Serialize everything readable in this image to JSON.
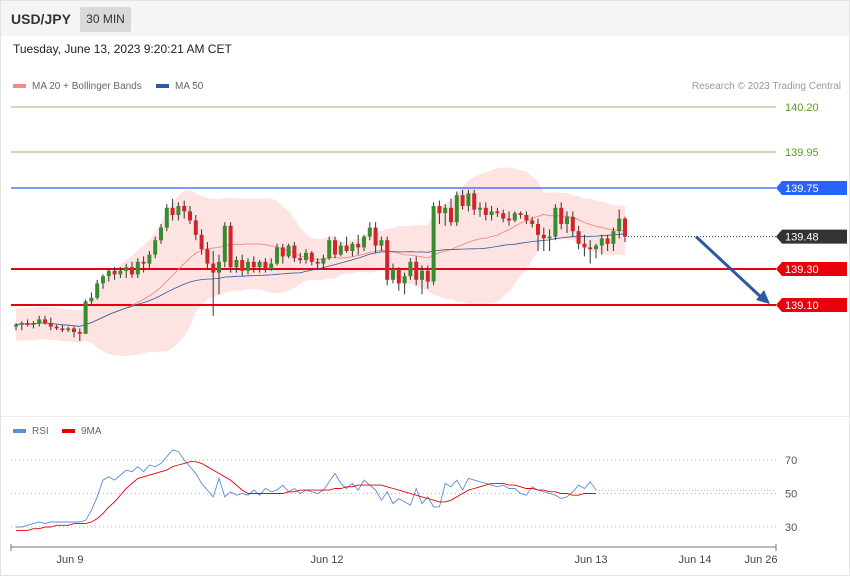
{
  "header": {
    "symbol": "USD/JPY",
    "timeframe": "30 MIN"
  },
  "timestamp": "Tuesday, June 13, 2023 9:20:21 AM CET",
  "legend": {
    "ma20": {
      "label": "MA 20 + Bollinger Bands",
      "color": "#f28b82"
    },
    "ma50": {
      "label": "MA 50",
      "color": "#2c5aa0"
    },
    "rsi": {
      "label": "RSI",
      "color": "#5b8dd9"
    },
    "ma9": {
      "label": "9MA",
      "color": "#e8000b"
    }
  },
  "credit": "Research © 2023 Trading Central",
  "chart_data": {
    "type": "candlestick",
    "y_range": [
      139.03,
      139.85
    ],
    "levels": [
      {
        "value": 140.2,
        "label": "140.20",
        "color": "#5a9e1f",
        "style": "target"
      },
      {
        "value": 139.95,
        "label": "139.95",
        "color": "#5a9e1f",
        "style": "target"
      },
      {
        "value": 139.75,
        "label": "139.75",
        "color": "#2962ff",
        "style": "resistance"
      },
      {
        "value": 139.48,
        "label": "139.48",
        "color": "#333333",
        "style": "last"
      },
      {
        "value": 139.3,
        "label": "139.30",
        "color": "#e8000b",
        "style": "support"
      },
      {
        "value": 139.1,
        "label": "139.10",
        "color": "#e8000b",
        "style": "support"
      }
    ],
    "forecast_arrow": {
      "from": 139.48,
      "to": 139.1,
      "direction": "down",
      "color": "#2c5aa0"
    },
    "x_labels": [
      "Jun 9",
      "Jun 12",
      "Jun 13",
      "Jun 14",
      "Jun 26"
    ],
    "candles": [
      [
        138.98,
        139.0,
        138.96,
        138.99
      ],
      [
        138.99,
        139.01,
        138.96,
        139.0
      ],
      [
        139.0,
        139.02,
        138.98,
        138.99
      ],
      [
        138.99,
        139.01,
        138.97,
        139.0
      ],
      [
        139.0,
        139.04,
        138.98,
        139.02
      ],
      [
        139.02,
        139.04,
        138.99,
        139.0
      ],
      [
        139.0,
        139.03,
        138.96,
        138.98
      ],
      [
        138.98,
        138.99,
        138.96,
        138.97
      ],
      [
        138.97,
        138.99,
        138.95,
        138.96
      ],
      [
        138.96,
        138.98,
        138.95,
        138.97
      ],
      [
        138.97,
        138.98,
        138.92,
        138.95
      ],
      [
        138.95,
        138.97,
        138.9,
        138.94
      ],
      [
        138.94,
        139.13,
        138.94,
        139.12
      ],
      [
        139.12,
        139.17,
        139.1,
        139.14
      ],
      [
        139.14,
        139.24,
        139.13,
        139.22
      ],
      [
        139.22,
        139.27,
        139.19,
        139.26
      ],
      [
        139.26,
        139.3,
        139.23,
        139.29
      ],
      [
        139.29,
        139.31,
        139.24,
        139.27
      ],
      [
        139.27,
        139.31,
        139.25,
        139.29
      ],
      [
        139.29,
        139.33,
        139.25,
        139.31
      ],
      [
        139.31,
        139.34,
        139.25,
        139.27
      ],
      [
        139.27,
        139.36,
        139.25,
        139.34
      ],
      [
        139.34,
        139.37,
        139.28,
        139.33
      ],
      [
        139.33,
        139.4,
        139.3,
        139.38
      ],
      [
        139.38,
        139.48,
        139.36,
        139.46
      ],
      [
        139.46,
        139.55,
        139.44,
        139.53
      ],
      [
        139.53,
        139.66,
        139.51,
        139.64
      ],
      [
        139.64,
        139.69,
        139.57,
        139.6
      ],
      [
        139.6,
        139.67,
        139.57,
        139.65
      ],
      [
        139.65,
        139.68,
        139.58,
        139.62
      ],
      [
        139.62,
        139.65,
        139.55,
        139.57
      ],
      [
        139.57,
        139.6,
        139.46,
        139.49
      ],
      [
        139.49,
        139.52,
        139.38,
        139.41
      ],
      [
        139.41,
        139.45,
        139.3,
        139.33
      ],
      [
        139.33,
        139.4,
        139.04,
        139.28
      ],
      [
        139.28,
        139.38,
        139.16,
        139.34
      ],
      [
        139.34,
        139.56,
        139.31,
        139.54
      ],
      [
        139.54,
        139.56,
        139.28,
        139.31
      ],
      [
        139.31,
        139.37,
        139.28,
        139.35
      ],
      [
        139.35,
        139.38,
        139.26,
        139.29
      ],
      [
        139.29,
        139.36,
        139.27,
        139.34
      ],
      [
        139.34,
        139.37,
        139.28,
        139.31
      ],
      [
        139.31,
        139.35,
        139.28,
        139.34
      ],
      [
        139.34,
        139.36,
        139.28,
        139.3
      ],
      [
        139.3,
        139.36,
        139.29,
        139.33
      ],
      [
        139.33,
        139.44,
        139.32,
        139.42
      ],
      [
        139.42,
        139.44,
        139.33,
        139.37
      ],
      [
        139.37,
        139.44,
        139.36,
        139.43
      ],
      [
        139.43,
        139.45,
        139.34,
        139.36
      ],
      [
        139.36,
        139.39,
        139.33,
        139.35
      ],
      [
        139.35,
        139.41,
        139.33,
        139.39
      ],
      [
        139.39,
        139.4,
        139.32,
        139.34
      ],
      [
        139.34,
        139.36,
        139.3,
        139.33
      ],
      [
        139.33,
        139.38,
        139.3,
        139.36
      ],
      [
        139.36,
        139.48,
        139.35,
        139.46
      ],
      [
        139.46,
        139.48,
        139.36,
        139.38
      ],
      [
        139.38,
        139.45,
        139.37,
        139.43
      ],
      [
        139.43,
        139.48,
        139.39,
        139.4
      ],
      [
        139.4,
        139.45,
        139.37,
        139.44
      ],
      [
        139.44,
        139.49,
        139.38,
        139.42
      ],
      [
        139.42,
        139.49,
        139.4,
        139.48
      ],
      [
        139.48,
        139.56,
        139.46,
        139.53
      ],
      [
        139.53,
        139.56,
        139.39,
        139.43
      ],
      [
        139.43,
        139.48,
        139.4,
        139.46
      ],
      [
        139.46,
        139.48,
        139.21,
        139.24
      ],
      [
        139.24,
        139.33,
        139.22,
        139.3
      ],
      [
        139.3,
        139.31,
        139.18,
        139.22
      ],
      [
        139.22,
        139.28,
        139.16,
        139.26
      ],
      [
        139.26,
        139.36,
        139.24,
        139.34
      ],
      [
        139.34,
        139.37,
        139.21,
        139.24
      ],
      [
        139.24,
        139.32,
        139.16,
        139.29
      ],
      [
        139.29,
        139.32,
        139.19,
        139.23
      ],
      [
        139.23,
        139.67,
        139.21,
        139.65
      ],
      [
        139.65,
        139.68,
        139.55,
        139.61
      ],
      [
        139.61,
        139.66,
        139.54,
        139.64
      ],
      [
        139.64,
        139.69,
        139.54,
        139.56
      ],
      [
        139.56,
        139.73,
        139.54,
        139.71
      ],
      [
        139.71,
        139.74,
        139.63,
        139.65
      ],
      [
        139.65,
        139.74,
        139.62,
        139.72
      ],
      [
        139.72,
        139.74,
        139.6,
        139.63
      ],
      [
        139.63,
        139.67,
        139.59,
        139.64
      ],
      [
        139.64,
        139.67,
        139.57,
        139.6
      ],
      [
        139.6,
        139.65,
        139.57,
        139.62
      ],
      [
        139.62,
        139.64,
        139.59,
        139.61
      ],
      [
        139.61,
        139.63,
        139.56,
        139.58
      ],
      [
        139.58,
        139.62,
        139.54,
        139.57
      ],
      [
        139.57,
        139.62,
        139.56,
        139.61
      ],
      [
        139.61,
        139.62,
        139.58,
        139.6
      ],
      [
        139.6,
        139.62,
        139.55,
        139.57
      ],
      [
        139.57,
        139.59,
        139.53,
        139.55
      ],
      [
        139.55,
        139.58,
        139.4,
        139.49
      ],
      [
        139.49,
        139.53,
        139.4,
        139.47
      ],
      [
        139.47,
        139.52,
        139.4,
        139.48
      ],
      [
        139.48,
        139.66,
        139.46,
        139.64
      ],
      [
        139.64,
        139.67,
        139.52,
        139.55
      ],
      [
        139.55,
        139.62,
        139.5,
        139.59
      ],
      [
        139.59,
        139.62,
        139.48,
        139.51
      ],
      [
        139.51,
        139.54,
        139.41,
        139.44
      ],
      [
        139.44,
        139.49,
        139.37,
        139.42
      ],
      [
        139.42,
        139.46,
        139.33,
        139.41
      ],
      [
        139.41,
        139.44,
        139.36,
        139.43
      ],
      [
        139.43,
        139.49,
        139.38,
        139.47
      ],
      [
        139.47,
        139.49,
        139.4,
        139.44
      ],
      [
        139.44,
        139.53,
        139.4,
        139.51
      ],
      [
        139.51,
        139.63,
        139.47,
        139.58
      ],
      [
        139.58,
        139.59,
        139.45,
        139.48
      ]
    ],
    "rsi": {
      "ticks": [
        "70",
        "50",
        "30"
      ],
      "values": [
        30,
        30,
        31,
        32,
        33,
        32,
        33,
        33,
        33,
        33,
        33,
        33,
        34,
        40,
        48,
        58,
        60,
        58,
        61,
        64,
        63,
        66,
        63,
        67,
        66,
        68,
        72,
        76,
        75,
        70,
        66,
        62,
        56,
        52,
        48,
        59,
        48,
        51,
        49,
        50,
        49,
        52,
        49,
        53,
        51,
        52,
        55,
        51,
        53,
        50,
        52,
        51,
        50,
        52,
        57,
        62,
        56,
        53,
        56,
        52,
        58,
        55,
        52,
        46,
        51,
        44,
        47,
        45,
        43,
        53,
        44,
        48,
        42,
        42,
        56,
        54,
        58,
        52,
        59,
        58,
        57,
        56,
        55,
        54,
        55,
        53,
        53,
        50,
        49,
        54,
        52,
        51,
        50,
        49,
        47,
        48,
        51,
        55,
        53,
        57,
        52
      ],
      "ma9": [
        28,
        28,
        28,
        29,
        29,
        30,
        30,
        31,
        31,
        31,
        32,
        32,
        32,
        33,
        35,
        38,
        42,
        45,
        49,
        53,
        56,
        59,
        60,
        61,
        62,
        63,
        64,
        66,
        67,
        68,
        69,
        69,
        68,
        66,
        64,
        62,
        60,
        58,
        55,
        52,
        50,
        50,
        50,
        50,
        50,
        50,
        50,
        51,
        51,
        52,
        52,
        52,
        52,
        52,
        52,
        53,
        53,
        54,
        54,
        55,
        55,
        55,
        55,
        55,
        54,
        53,
        52,
        51,
        50,
        49,
        48,
        47,
        46,
        45,
        45,
        46,
        48,
        50,
        52,
        53,
        54,
        55,
        56,
        56,
        56,
        55,
        55,
        54,
        53,
        53,
        52,
        52,
        51,
        51,
        50,
        50,
        49,
        49,
        50,
        50,
        50
      ]
    }
  }
}
